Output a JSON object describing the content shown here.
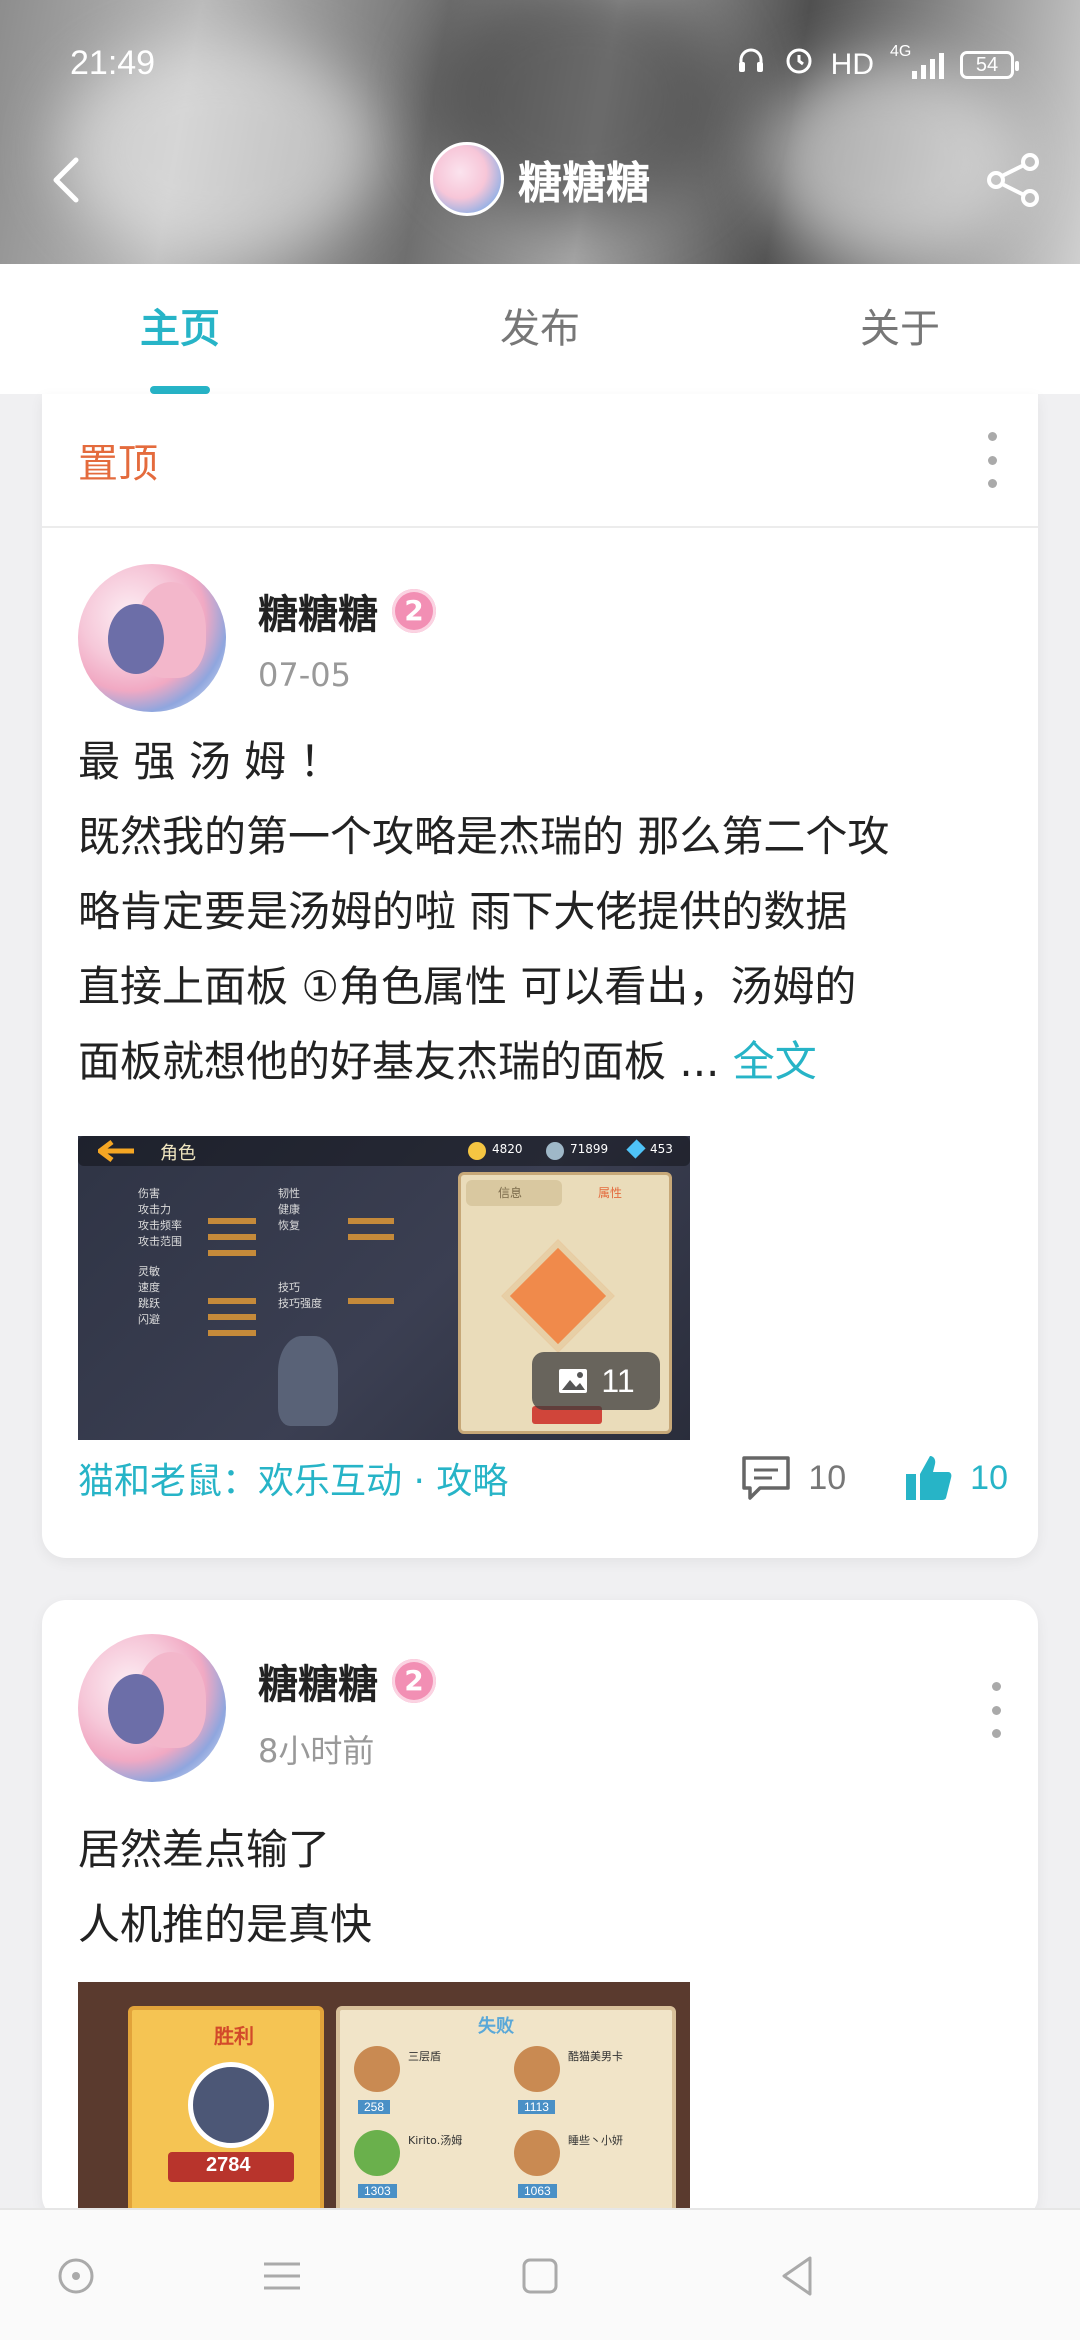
{
  "status_bar": {
    "time": "21:49",
    "network": "HD",
    "network_type": "4G",
    "battery": "54"
  },
  "header": {
    "title": "糖糖糖"
  },
  "tabs": [
    {
      "label": "主页",
      "active": true
    },
    {
      "label": "发布",
      "active": false
    },
    {
      "label": "关于",
      "active": false
    }
  ],
  "posts": [
    {
      "pinned_label": "置顶",
      "author": "糖糖糖",
      "level": "2",
      "date": "07-05",
      "text_lines": [
        "最 强 汤 姆 ！",
        "既然我的第一个攻略是杰瑞的 那么第二个攻",
        "略肯定要是汤姆的啦 雨下大佬提供的数据",
        "直接上面板 ①角色属性 可以看出，汤姆的",
        "面板就想他的好基友杰瑞的面板 ..."
      ],
      "full_text_label": "全文",
      "image_count": "11",
      "topic": "猫和老鼠：欢乐互动 · 攻略",
      "comments": "10",
      "likes": "10"
    },
    {
      "author": "糖糖糖",
      "level": "2",
      "date": "8小时前",
      "text_lines": [
        "居然差点输了",
        "人机推的是真快"
      ]
    }
  ],
  "thumbnail_text": {
    "game_topbar_title": "角色",
    "gold": "4820",
    "silver": "71899",
    "gem": "453",
    "tab_info": "信息",
    "tab_attr": "属性",
    "stat_labels": [
      "伤害",
      "攻击力",
      "攻击频率",
      "攻击范围",
      "韧性",
      "健康",
      "恢复",
      "灵敏",
      "速度",
      "跳跃",
      "闪避",
      "技巧",
      "技巧强度"
    ],
    "stat_values": [
      "6",
      "7",
      "7",
      "9",
      "7",
      "7",
      "7",
      "7",
      "6"
    ],
    "second_victory": "胜利",
    "second_defeat": "失败",
    "second_score": "2784",
    "second_names": [
      "三层盾",
      "酷猫美男卡",
      "Kirito.汤姆",
      "睡些丶小妍"
    ],
    "second_numbers": [
      "258",
      "1113",
      "1303",
      "1063"
    ]
  },
  "colors": {
    "accent": "#27b4c7",
    "pinned": "#e46b3d",
    "level_badge": "#f28fb4"
  },
  "nav_icons": [
    "circle-icon",
    "menu-icon",
    "square-icon",
    "back-triangle-icon"
  ]
}
